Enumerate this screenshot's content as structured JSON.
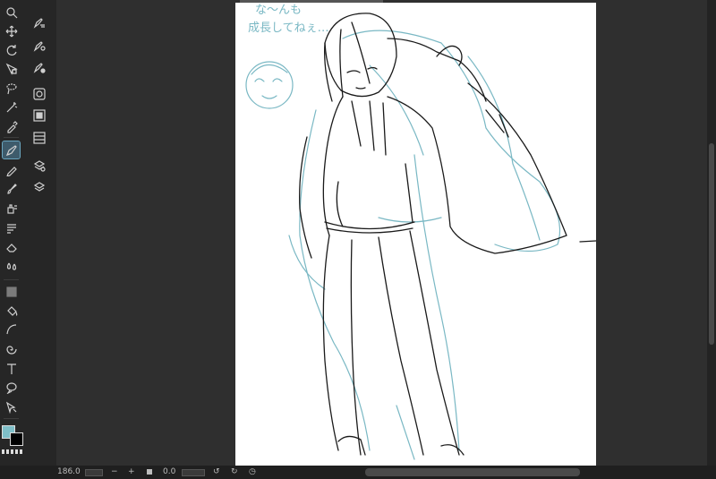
{
  "tools": {
    "main": [
      {
        "name": "zoom-tool",
        "icon": "magnifier-icon"
      },
      {
        "name": "move-tool",
        "icon": "move-arrows-icon"
      },
      {
        "name": "rotate-tool",
        "icon": "rotate-icon"
      },
      {
        "name": "object-select-tool",
        "icon": "object-select-icon"
      },
      {
        "name": "selection-tool",
        "icon": "lasso-select-icon"
      },
      {
        "name": "magic-wand-tool",
        "icon": "magic-wand-icon"
      },
      {
        "name": "eyedropper-tool",
        "icon": "eyedropper-icon"
      },
      {
        "name": "pen-tool",
        "icon": "pen-icon",
        "active": true
      },
      {
        "name": "pencil-tool",
        "icon": "pencil-icon"
      },
      {
        "name": "brush-tool",
        "icon": "brush-icon"
      },
      {
        "name": "airbrush-tool",
        "icon": "airbrush-icon"
      },
      {
        "name": "decoration-tool",
        "icon": "decoration-icon"
      },
      {
        "name": "eraser-tool",
        "icon": "eraser-icon"
      },
      {
        "name": "blend-tool",
        "icon": "blend-drops-icon"
      },
      {
        "name": "gradient-tool",
        "icon": "gradient-icon"
      },
      {
        "name": "fill-tool",
        "icon": "paint-bucket-icon"
      },
      {
        "name": "figure-tool",
        "icon": "curve-icon"
      },
      {
        "name": "ruler-tool",
        "icon": "spiral-icon"
      },
      {
        "name": "text-tool",
        "icon": "text-icon"
      },
      {
        "name": "balloon-tool",
        "icon": "speech-balloon-icon"
      },
      {
        "name": "correct-line-tool",
        "icon": "correct-line-icon"
      }
    ],
    "sub": [
      {
        "name": "sub-tool-properties",
        "icon": "tool-properties-icon"
      },
      {
        "name": "sub-tool-settings",
        "icon": "tool-settings-icon"
      },
      {
        "name": "brush-size",
        "icon": "brush-size-icon"
      },
      {
        "name": "color-circle",
        "icon": "color-circle-icon"
      },
      {
        "name": "navigator",
        "icon": "navigator-icon"
      },
      {
        "name": "material",
        "icon": "material-icon"
      },
      {
        "name": "layer-properties",
        "icon": "layer-properties-icon"
      },
      {
        "name": "layers",
        "icon": "layers-icon"
      }
    ]
  },
  "colors": {
    "main_color": "#7fbfc8",
    "sub_color": "#000000",
    "active_tool_bg": "#3e5b6b",
    "sketch_blue": "#7ab8c4",
    "sketch_black": "#1a1a1a"
  },
  "canvas": {
    "note_line1": "な〜んも",
    "note_line2": "成長してねぇ…"
  },
  "statusbar": {
    "zoom": "186.0",
    "zoom_out": "−",
    "zoom_in": "+",
    "rotation": "0.0"
  }
}
